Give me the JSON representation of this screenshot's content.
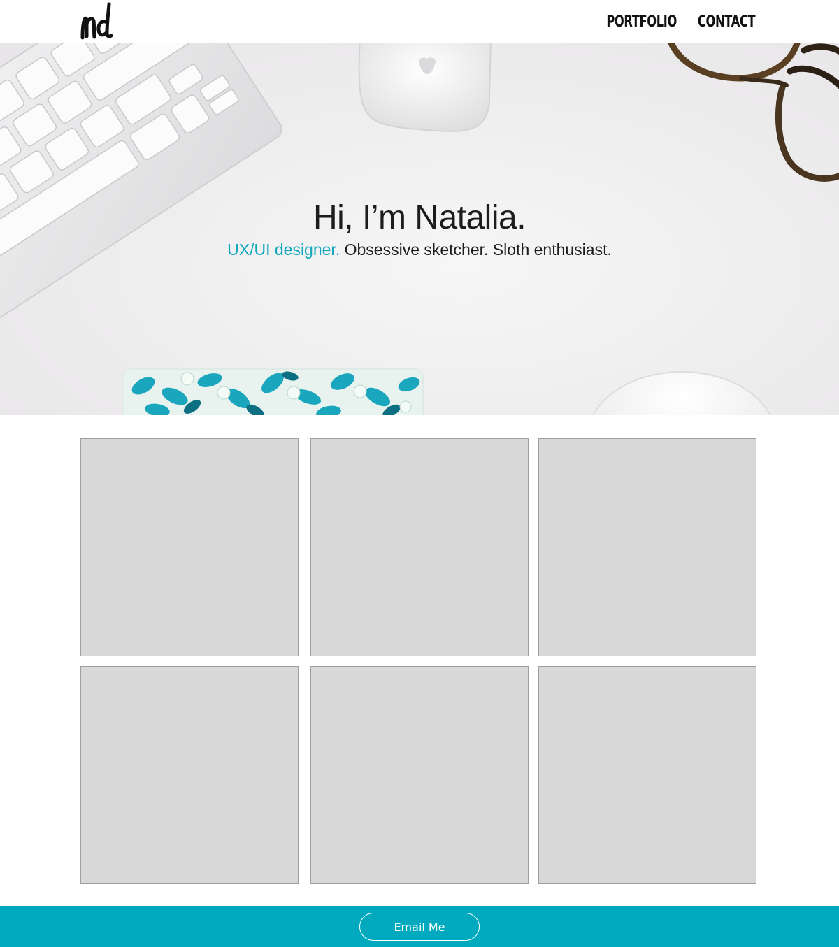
{
  "header": {
    "logo_text": "nd",
    "nav": [
      {
        "label": "PORTFOLIO"
      },
      {
        "label": "CONTACT"
      }
    ]
  },
  "hero": {
    "title": "Hi, I’m Natalia.",
    "subtitle_accent": "UX/UI designer.",
    "subtitle_rest": " Obsessive sketcher. Sloth enthusiast."
  },
  "portfolio": {
    "tile_count": 6
  },
  "footer": {
    "email_button": "Email Me"
  },
  "colors": {
    "accent": "#11a7bd",
    "footer_bg": "#00a9be",
    "tile_bg": "#d8d8d8",
    "tile_border": "#9e9e9e"
  }
}
